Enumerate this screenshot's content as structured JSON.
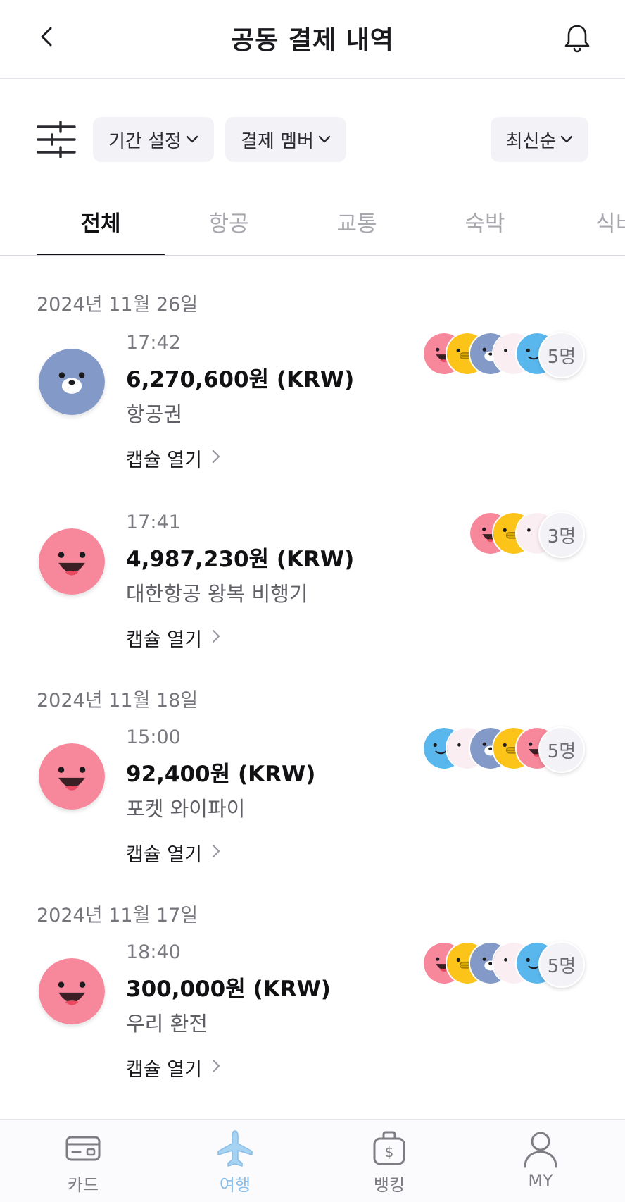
{
  "header": {
    "title": "공동 결제 내역"
  },
  "filters": {
    "period": "기간 설정",
    "members": "결제 멤버",
    "sort": "최신순",
    "chevron": "⌄"
  },
  "tabs": [
    "전체",
    "항공",
    "교통",
    "숙박",
    "식비"
  ],
  "active_tab": "전체",
  "capsule_label": "캡슐 열기",
  "groups": [
    {
      "date": "2024년 11월 26일",
      "items": [
        {
          "time": "17:42",
          "amount": "6,270,600원 (KRW)",
          "merchant": "항공권",
          "avatar": "blue-bear",
          "members": [
            "pink",
            "yellow",
            "blue-bear",
            "white",
            "sky"
          ],
          "count": "5명"
        },
        {
          "time": "17:41",
          "amount": "4,987,230원 (KRW)",
          "merchant": "대한항공 왕복 비행기",
          "avatar": "pink",
          "members": [
            "pink",
            "yellow",
            "white"
          ],
          "count": "3명"
        }
      ]
    },
    {
      "date": "2024년 11월 18일",
      "items": [
        {
          "time": "15:00",
          "amount": "92,400원 (KRW)",
          "merchant": "포켓 와이파이",
          "avatar": "pink",
          "members": [
            "sky",
            "white",
            "blue-bear",
            "yellow",
            "pink"
          ],
          "count": "5명"
        }
      ]
    },
    {
      "date": "2024년 11월 17일",
      "items": [
        {
          "time": "18:40",
          "amount": "300,000원 (KRW)",
          "merchant": "우리 환전",
          "avatar": "pink",
          "members": [
            "pink",
            "yellow",
            "blue-bear",
            "white",
            "sky"
          ],
          "count": "5명"
        }
      ]
    }
  ],
  "bottom_nav": [
    {
      "label": "카드",
      "icon": "card-icon"
    },
    {
      "label": "여행",
      "icon": "airplane-icon",
      "active": true
    },
    {
      "label": "뱅킹",
      "icon": "bank-bag-icon"
    },
    {
      "label": "MY",
      "icon": "person-icon"
    }
  ],
  "colors": {
    "accent": "#88bde8",
    "pink": "#f7879a",
    "yellow": "#fcc419",
    "blue_bear": "#8399c8",
    "white_face": "#fbeef2",
    "sky": "#5ab7ee"
  }
}
